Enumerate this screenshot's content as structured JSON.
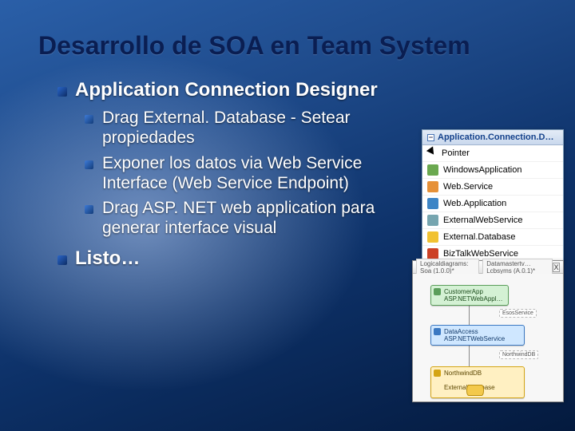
{
  "title": "Desarrollo de SOA en Team System",
  "bullets": {
    "section1": "Application Connection Designer",
    "sub": [
      "Drag External. Database - Setear propiedades",
      "Exponer los datos via Web Service Interface (Web Service Endpoint)",
      "Drag ASP. NET web application para generar interface visual"
    ],
    "section2": "Listo…"
  },
  "toolbox": {
    "header": "Application.Connection.D…",
    "items": [
      "Pointer",
      "WindowsApplication",
      "Web.Service",
      "Web.Application",
      "ExternalWebService",
      "External.Database",
      "BizTalkWebService"
    ]
  },
  "diagram": {
    "tab1": "Logicaldiagrams: Soa (1.0.0)*",
    "tab2": "Datamastertv… Lcbsyms (A.0.1)*",
    "close": "X",
    "nodes": {
      "customer": "CustomerApp\nASP.NETWebAppl…",
      "asp": "DataAccess\nASP.NETWebService",
      "db": "NorthwindDB\n\nExternalDatabase"
    },
    "endpoints": {
      "ep1": "EsosService",
      "ep2": "NorthwindDB"
    }
  }
}
